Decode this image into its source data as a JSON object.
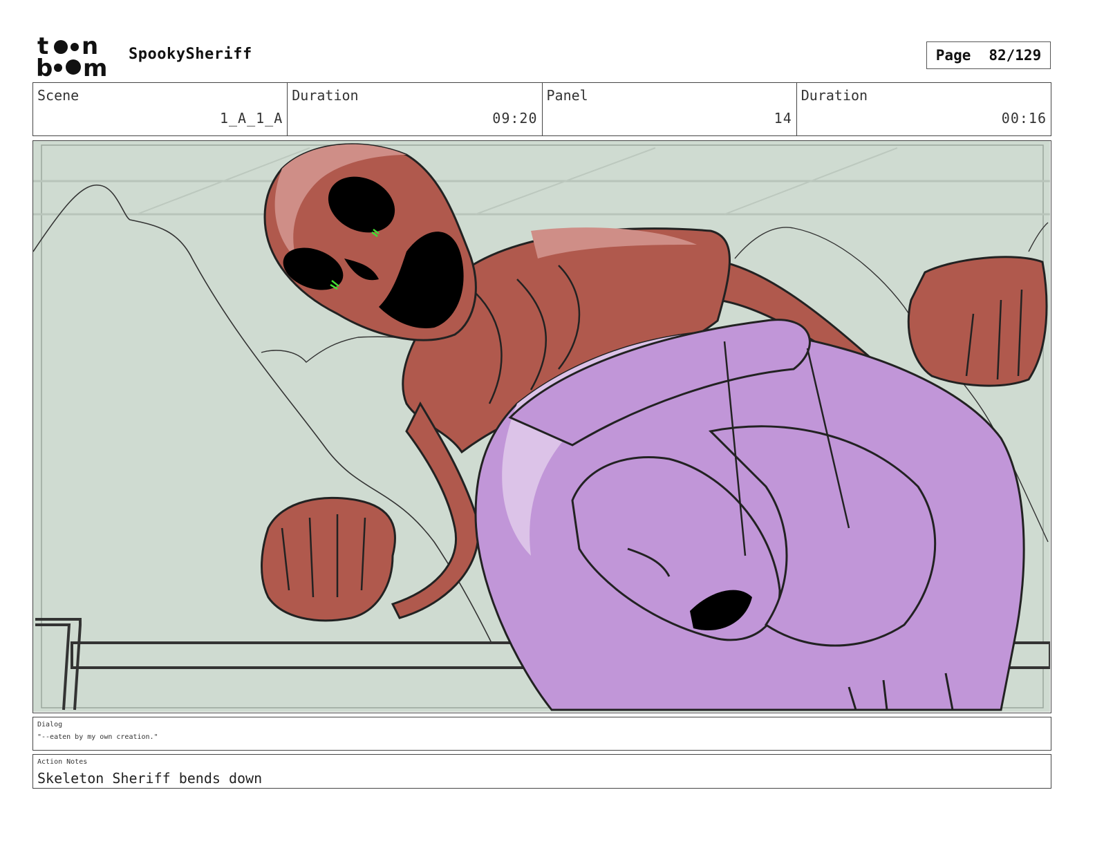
{
  "header": {
    "logo_text": "toon boom",
    "project_title": "SpookySheriff",
    "page_label": "Page",
    "page_value": "82/129"
  },
  "info": {
    "scene_label": "Scene",
    "scene_value": "1_A_1_A",
    "scene_duration_label": "Duration",
    "scene_duration_value": "09:20",
    "panel_label": "Panel",
    "panel_value": "14",
    "panel_duration_label": "Duration",
    "panel_duration_value": "00:16"
  },
  "dialog": {
    "label": "Dialog",
    "text": "\"--eaten by my own creation.\""
  },
  "action_notes": {
    "label": "Action Notes",
    "text": "Skeleton Sheriff bends down"
  },
  "colors": {
    "sky": "#cfdbd1",
    "skeleton": "#b0594d",
    "skeleton_light": "#cf8e87",
    "sheriff_purple": "#c196d8",
    "sheriff_light": "#dcc3e8",
    "eye_green": "#44dd33"
  }
}
